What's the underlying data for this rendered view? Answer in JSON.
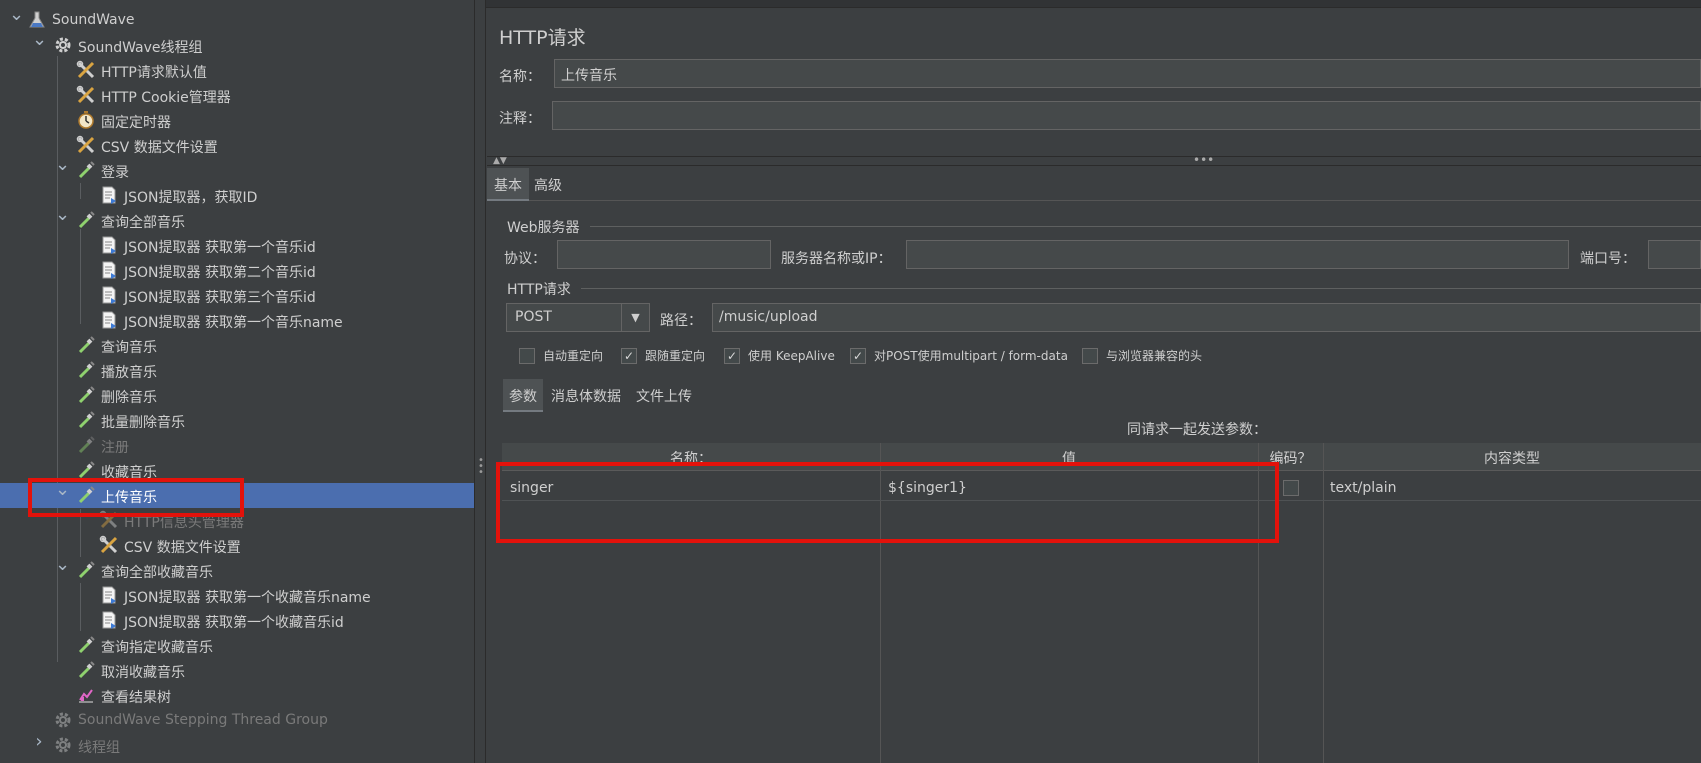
{
  "tree": {
    "items": [
      {
        "label": "SoundWave",
        "icon": "testplan-flask-icon",
        "expanded": true
      },
      {
        "label": "SoundWave线程组",
        "icon": "thread-group-gear-icon",
        "expanded": true
      },
      {
        "label": "HTTP请求默认值",
        "icon": "config-wrench-icon"
      },
      {
        "label": "HTTP Cookie管理器",
        "icon": "config-wrench-icon"
      },
      {
        "label": "固定定时器",
        "icon": "timer-clock-icon"
      },
      {
        "label": "CSV 数据文件设置",
        "icon": "config-wrench-icon"
      },
      {
        "label": "登录",
        "icon": "sampler-pipette-icon",
        "expanded": true
      },
      {
        "label": "JSON提取器，获取ID",
        "icon": "extractor-doc-icon"
      },
      {
        "label": "查询全部音乐",
        "icon": "sampler-pipette-icon",
        "expanded": true
      },
      {
        "label": "JSON提取器 获取第一个音乐id",
        "icon": "extractor-doc-icon"
      },
      {
        "label": "JSON提取器 获取第二个音乐id",
        "icon": "extractor-doc-icon"
      },
      {
        "label": "JSON提取器 获取第三个音乐id",
        "icon": "extractor-doc-icon"
      },
      {
        "label": "JSON提取器 获取第一个音乐name",
        "icon": "extractor-doc-icon"
      },
      {
        "label": "查询音乐",
        "icon": "sampler-pipette-icon"
      },
      {
        "label": "播放音乐",
        "icon": "sampler-pipette-icon"
      },
      {
        "label": "删除音乐",
        "icon": "sampler-pipette-icon"
      },
      {
        "label": "批量删除音乐",
        "icon": "sampler-pipette-icon"
      },
      {
        "label": "注册",
        "icon": "sampler-pipette-icon",
        "disabled": true
      },
      {
        "label": "收藏音乐",
        "icon": "sampler-pipette-icon"
      },
      {
        "label": "上传音乐",
        "icon": "sampler-pipette-icon",
        "expanded": true,
        "selected": true
      },
      {
        "label": "HTTP信息头管理器",
        "icon": "config-wrench-icon",
        "disabled": true
      },
      {
        "label": "CSV 数据文件设置",
        "icon": "config-wrench-icon"
      },
      {
        "label": "查询全部收藏音乐",
        "icon": "sampler-pipette-icon",
        "expanded": true
      },
      {
        "label": "JSON提取器 获取第一个收藏音乐name",
        "icon": "extractor-doc-icon"
      },
      {
        "label": "JSON提取器 获取第一个收藏音乐id",
        "icon": "extractor-doc-icon"
      },
      {
        "label": "查询指定收藏音乐",
        "icon": "sampler-pipette-icon"
      },
      {
        "label": "取消收藏音乐",
        "icon": "sampler-pipette-icon"
      },
      {
        "label": "查看结果树",
        "icon": "listener-graph-icon"
      },
      {
        "label": "SoundWave Stepping Thread Group",
        "icon": "thread-group-gear-icon",
        "disabled": true
      },
      {
        "label": "线程组",
        "icon": "thread-group-gear-icon",
        "disabled": true,
        "expanded": false
      }
    ]
  },
  "panel": {
    "title": "HTTP请求",
    "name_label": "名称：",
    "name_value": "上传音乐",
    "comment_label": "注释：",
    "comment_value": "",
    "tabs": [
      "基本",
      "高级"
    ],
    "web_server": {
      "group_title": "Web服务器",
      "protocol_label": "协议：",
      "protocol_value": "",
      "server_label": "服务器名称或IP：",
      "server_value": "",
      "port_label": "端口号：",
      "port_value": ""
    },
    "http_request": {
      "group_title": "HTTP请求",
      "method": "POST",
      "path_label": "路径：",
      "path_value": "/music/upload"
    },
    "checkboxes": [
      {
        "label": "自动重定向",
        "checked": false
      },
      {
        "label": "跟随重定向",
        "checked": true
      },
      {
        "label": "使用 KeepAlive",
        "checked": true
      },
      {
        "label": "对POST使用multipart / form-data",
        "checked": true
      },
      {
        "label": "与浏览器兼容的头",
        "checked": false
      }
    ],
    "subtabs": [
      "参数",
      "消息体数据",
      "文件上传"
    ],
    "table": {
      "caption": "同请求一起发送参数：",
      "headers": [
        "名称：",
        "值",
        "编码？",
        "内容类型"
      ],
      "rows": [
        {
          "name": "singer",
          "value": "${singer1}",
          "encode": false,
          "content_type": "text/plain"
        }
      ]
    }
  },
  "colors": {
    "background": "#3c3f41",
    "selection": "#4b6eaf",
    "highlight_box": "#e3120b"
  }
}
